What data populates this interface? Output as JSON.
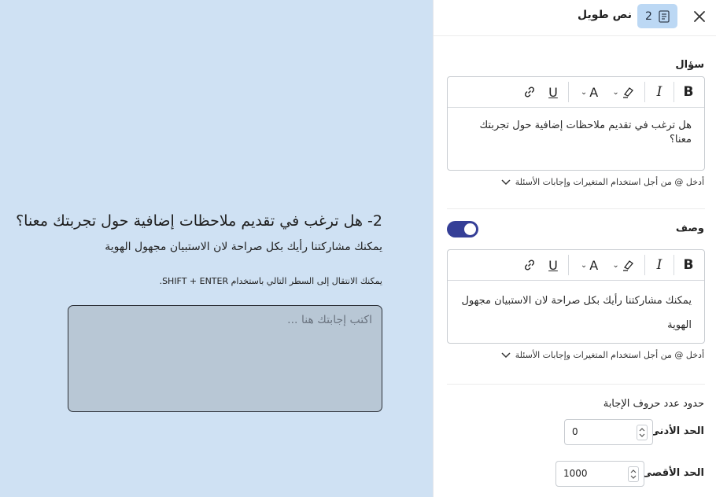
{
  "preview": {
    "question_title": "2- هل ترغب في تقديم ملاحظات إضافية حول تجربتك معنا؟",
    "description": "يمكنك مشاركتنا رأيك بكل صراحة لان الاستبيان مجهول الهوية",
    "hint": "يمكنك الانتقال إلى السطر التالي باستخدام SHIFT + ENTER.",
    "answer_placeholder": "اكتب إجابتك هنا ..."
  },
  "panel": {
    "question_number": "2",
    "question_type": "نص طويل",
    "question_label": "سؤال",
    "question_text": "هل ترغب في تقديم ملاحظات إضافية حول تجربتك معنا؟",
    "help_text": "أدخل @ من أجل استخدام المتغيرات وإجابات الأسئلة",
    "description_label": "وصف",
    "description_enabled": true,
    "description_text": "يمكنك مشاركتنا رأيك بكل صراحة لان الاستبيان مجهول الهوية",
    "limits_label": "حدود عدد حروف الإجابة",
    "min_label": "الحد الأدنى",
    "min_value": "0",
    "max_label": "الحد الأقصى",
    "max_value": "1000"
  },
  "toolbar": {
    "bold": "B",
    "italic": "I",
    "underline": "U",
    "font_size": "A"
  },
  "colors": {
    "preview_bg": "#cfe1f3",
    "answer_bg": "#b8c7d5",
    "accent": "#353f97",
    "badge_bg": "#bcd8f4"
  }
}
